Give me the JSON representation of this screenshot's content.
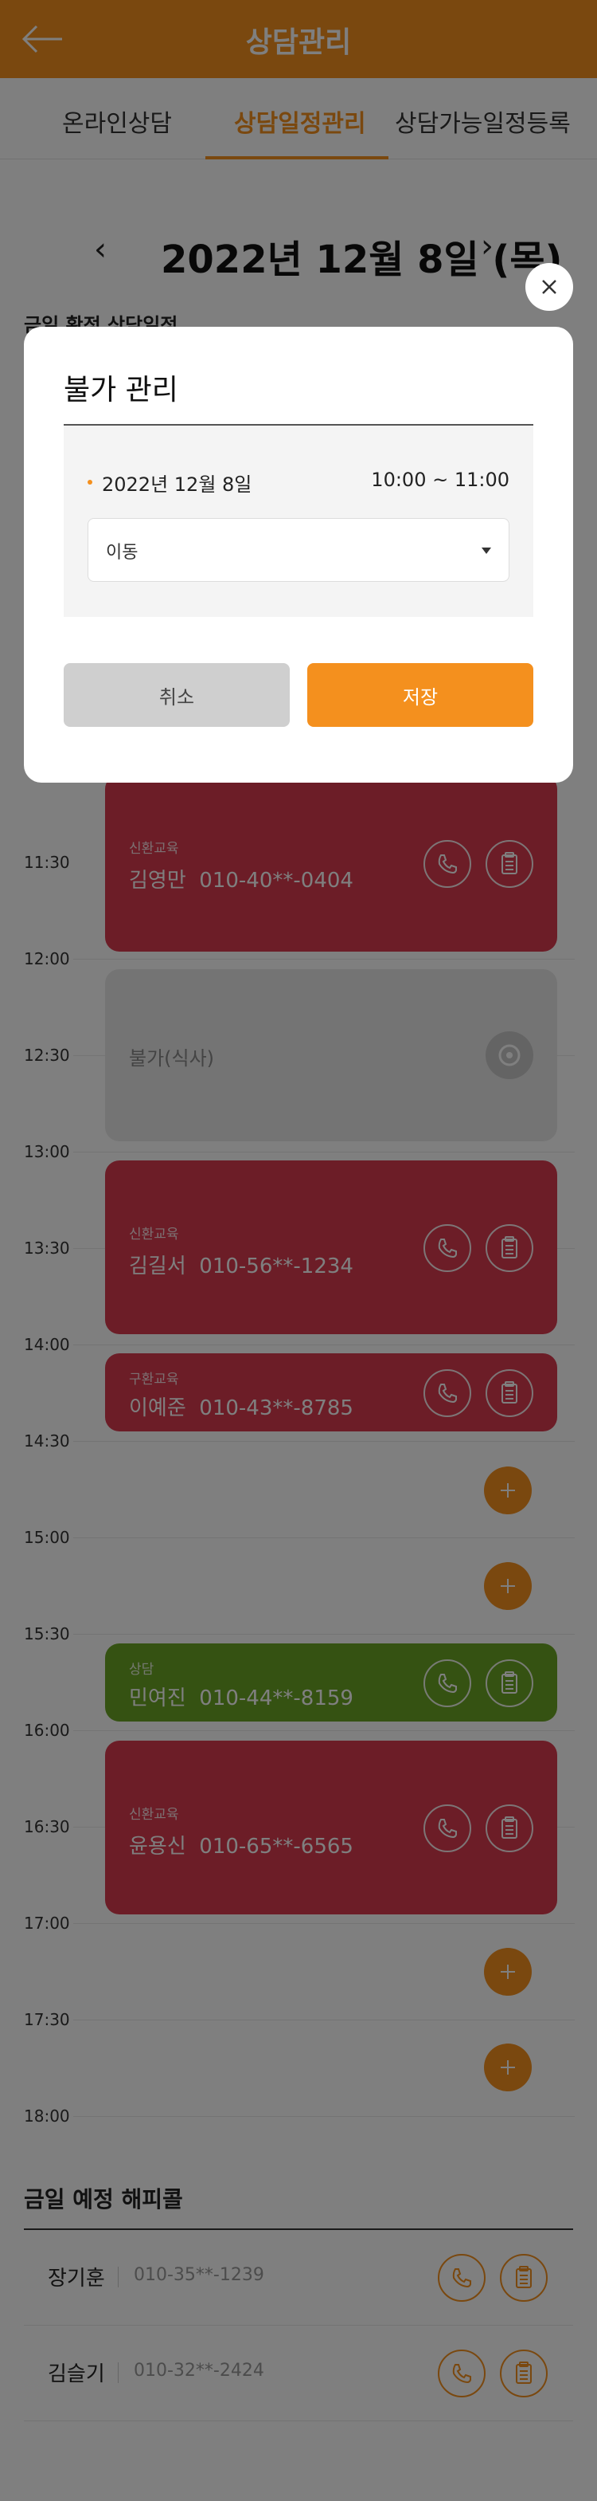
{
  "header": {
    "title": "상담관리"
  },
  "tabs": [
    {
      "label": "온라인상담",
      "active": false
    },
    {
      "label": "상담일정관리",
      "active": true
    },
    {
      "label": "상담가능일정등록",
      "active": false
    }
  ],
  "date_nav": {
    "prev": "‹",
    "date": "2022년 12월 8일 (목)",
    "next": "›"
  },
  "section_top": "금일 확정 상담일정",
  "timeline": {
    "times": [
      "11:30",
      "12:00",
      "12:30",
      "13:00",
      "13:30",
      "14:00",
      "14:30",
      "15:00",
      "15:30",
      "16:00",
      "16:30",
      "17:00",
      "17:30",
      "18:00"
    ],
    "cards": [
      {
        "category": "신환교육",
        "name": "김영만",
        "phone": "010-40**-0404"
      },
      {
        "label": "불가(식사)"
      },
      {
        "category": "신환교육",
        "name": "김길서",
        "phone": "010-56**-1234"
      },
      {
        "category": "구환교육",
        "name": "이예준",
        "phone": "010-43**-8785"
      },
      {
        "category": "상담",
        "name": "민여진",
        "phone": "010-44**-8159"
      },
      {
        "category": "신환교육",
        "name": "윤용신",
        "phone": "010-65**-6565"
      }
    ]
  },
  "happy_call": {
    "title": "금일 예정 해피콜",
    "items": [
      {
        "name": "장기훈",
        "phone": "010-35**-1239"
      },
      {
        "name": "김슬기",
        "phone": "010-32**-2424"
      }
    ]
  },
  "modal": {
    "title": "불가 관리",
    "date": "2022년 12월 8일",
    "time": "10:00 ~ 11:00",
    "select_value": "이동",
    "cancel_label": "취소",
    "save_label": "저장"
  },
  "colors": {
    "accent": "#f4901e",
    "red_card": "#d83a4e",
    "green_card": "#6aa425",
    "gray_card": "#e8e8e8"
  }
}
